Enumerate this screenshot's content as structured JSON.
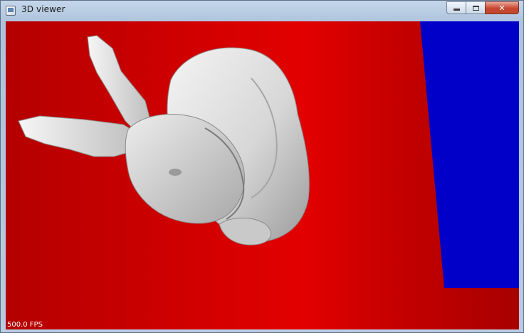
{
  "window": {
    "title": "3D viewer",
    "close_glyph": "✕"
  },
  "viewport": {
    "fps_label": "500.0 FPS",
    "colors": {
      "background_red": "#d40000",
      "plane_blue": "#0000c8",
      "model_gray": "#d2d2d2"
    },
    "model": "bunny-mesh"
  },
  "icons": [
    "app-icon",
    "minimize-icon",
    "maximize-icon",
    "close-icon"
  ]
}
